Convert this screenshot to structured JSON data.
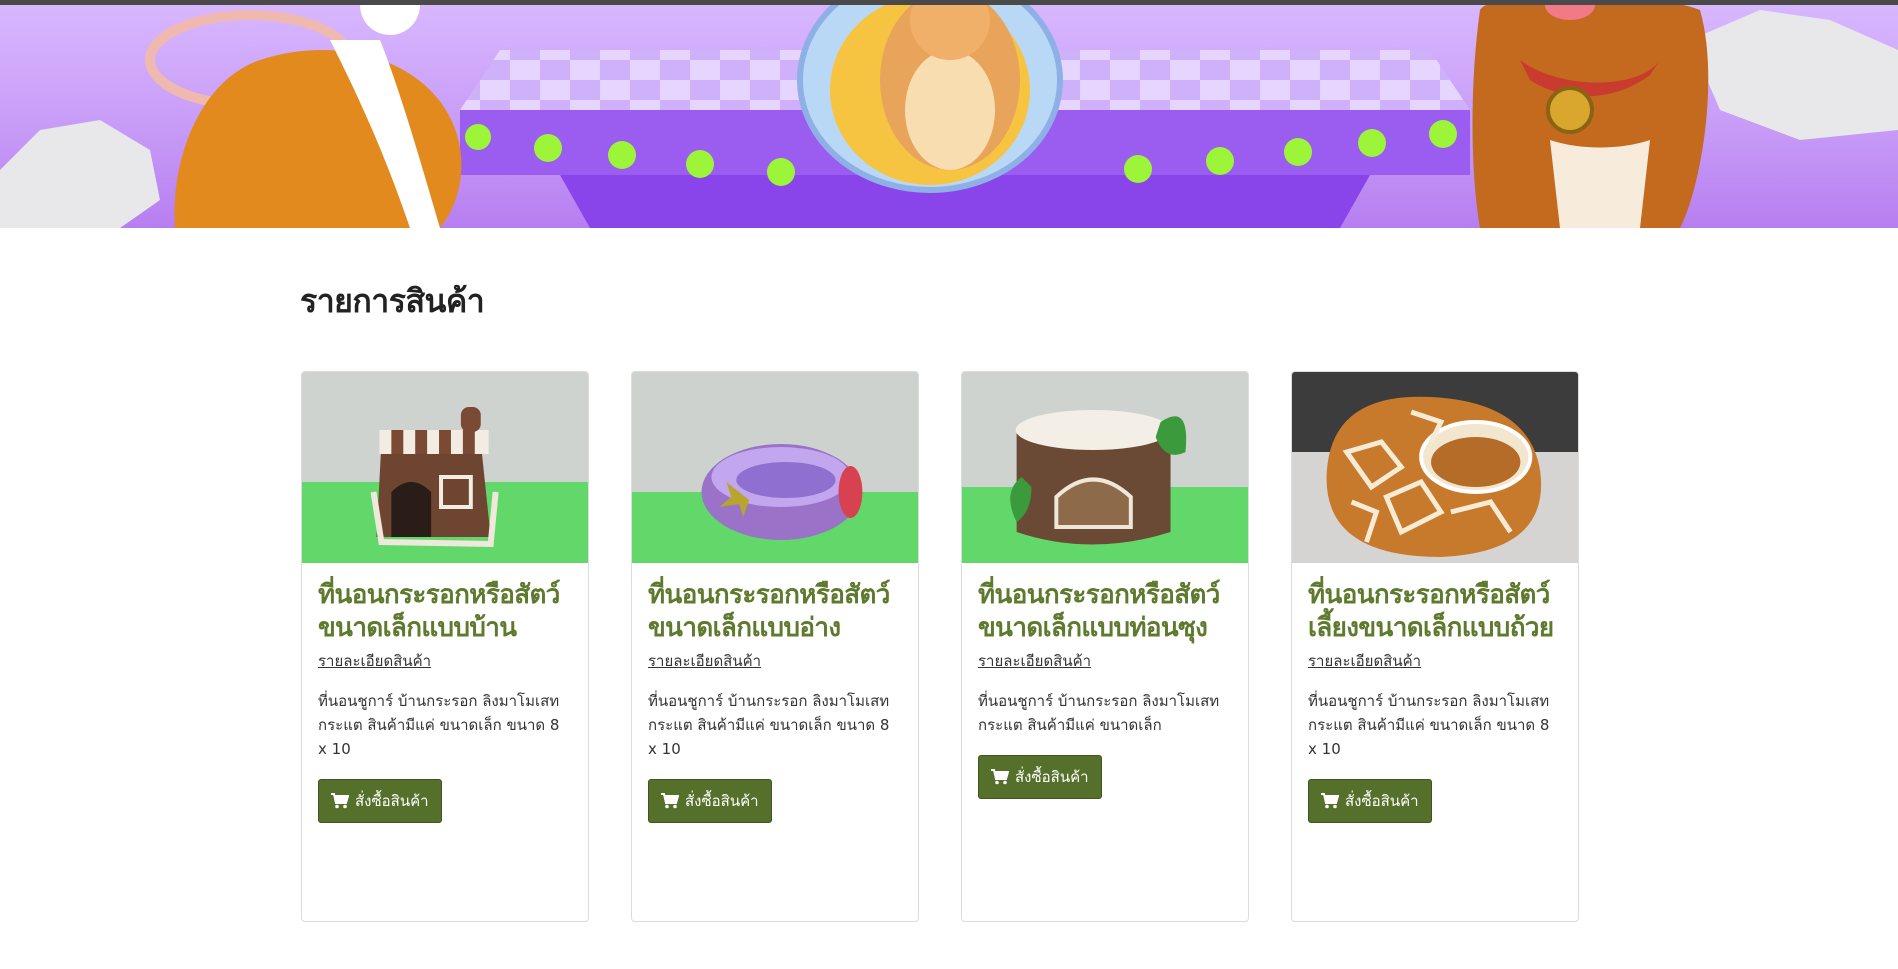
{
  "header": {
    "banner_image": "pet-cartoon-banner",
    "colors": {
      "sky": "#d9b8ff",
      "platform": "#9b5cf0",
      "dots": "#9df53a"
    }
  },
  "main": {
    "title": "รายการสินค้า"
  },
  "products": [
    {
      "title": "ที่นอนกระรอกหรือสัตว์ขนาดเล็กแบบบ้าน",
      "detail_link": "รายละเอียดสินค้า",
      "description": "ที่นอนชูการ์ บ้านกระรอก ลิงมาโมเสท กระแต สินค้ามีแค่ ขนาดเล็ก ขนาด 8 x 10",
      "button": "สั่งซื้อสินค้า",
      "image": "house-shaped-pet-bed"
    },
    {
      "title": "ที่นอนกระรอกหรือสัตว์ขนาดเล็กแบบอ่าง",
      "detail_link": "รายละเอียดสินค้า",
      "description": "ที่นอนชูการ์ บ้านกระรอก ลิงมาโมเสท กระแต สินค้ามีแค่ ขนาดเล็ก ขนาด 8 x 10",
      "button": "สั่งซื้อสินค้า",
      "image": "purple-tub-pet-bed"
    },
    {
      "title": "ที่นอนกระรอกหรือสัตว์ขนาดเล็กแบบท่อนซุง",
      "detail_link": "รายละเอียดสินค้า",
      "description": "ที่นอนชูการ์ บ้านกระรอก ลิงมาโมเสท กระแต สินค้ามีแค่ ขนาดเล็ก",
      "button": "สั่งซื้อสินค้า",
      "image": "log-shaped-pet-bed"
    },
    {
      "title": "ที่นอนกระรอกหรือสัตว์เลี้ยงขนาดเล็กแบบถ้วย",
      "detail_link": "รายละเอียดสินค้า",
      "description": "ที่นอนชูการ์ บ้านกระรอก ลิงมาโมเสท กระแต สินค้ามีแค่ ขนาดเล็ก ขนาด 8 x 10",
      "button": "สั่งซื้อสินค้า",
      "image": "giraffe-cup-pet-bed"
    }
  ],
  "icons": {
    "button_icon": "shopping-cart-icon"
  }
}
